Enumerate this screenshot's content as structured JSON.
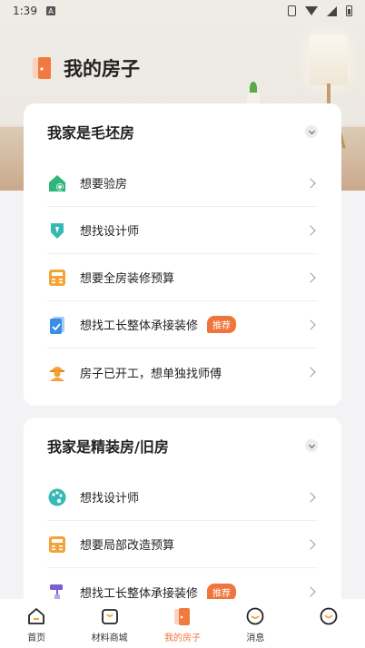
{
  "status_bar": {
    "time": "1:39",
    "notif_icon_letter": "A"
  },
  "page": {
    "title": "我的房子"
  },
  "sections": [
    {
      "title": "我家是毛坯房",
      "items": [
        {
          "label": "想要验房",
          "icon": "house-inspect-icon"
        },
        {
          "label": "想找设计师",
          "icon": "designer-pen-icon"
        },
        {
          "label": "想要全房装修预算",
          "icon": "calculator-icon"
        },
        {
          "label": "想找工长整体承接装修",
          "icon": "checklist-icon",
          "tag": "推荐"
        },
        {
          "label": "房子已开工，想单独找师傅",
          "icon": "worker-helmet-icon"
        }
      ]
    },
    {
      "title": "我家是精装房/旧房",
      "items": [
        {
          "label": "想找设计师",
          "icon": "palette-icon"
        },
        {
          "label": "想要局部改造预算",
          "icon": "calculator-icon"
        },
        {
          "label": "想找工长整体承接装修",
          "icon": "paint-roller-icon",
          "tag": "推荐"
        }
      ]
    }
  ],
  "bottom_nav": [
    {
      "label": "首页",
      "icon": "home-icon"
    },
    {
      "label": "材料商城",
      "icon": "shopping-bag-icon"
    },
    {
      "label": "我的房子",
      "icon": "door-icon",
      "active": true
    },
    {
      "label": "消息",
      "icon": "message-icon"
    },
    {
      "label": "",
      "icon": "profile-icon"
    }
  ],
  "colors": {
    "accent": "#f0753b",
    "green": "#2fb57a",
    "teal": "#35b9b4",
    "blue": "#3a8ee6",
    "orange": "#f4a338"
  }
}
